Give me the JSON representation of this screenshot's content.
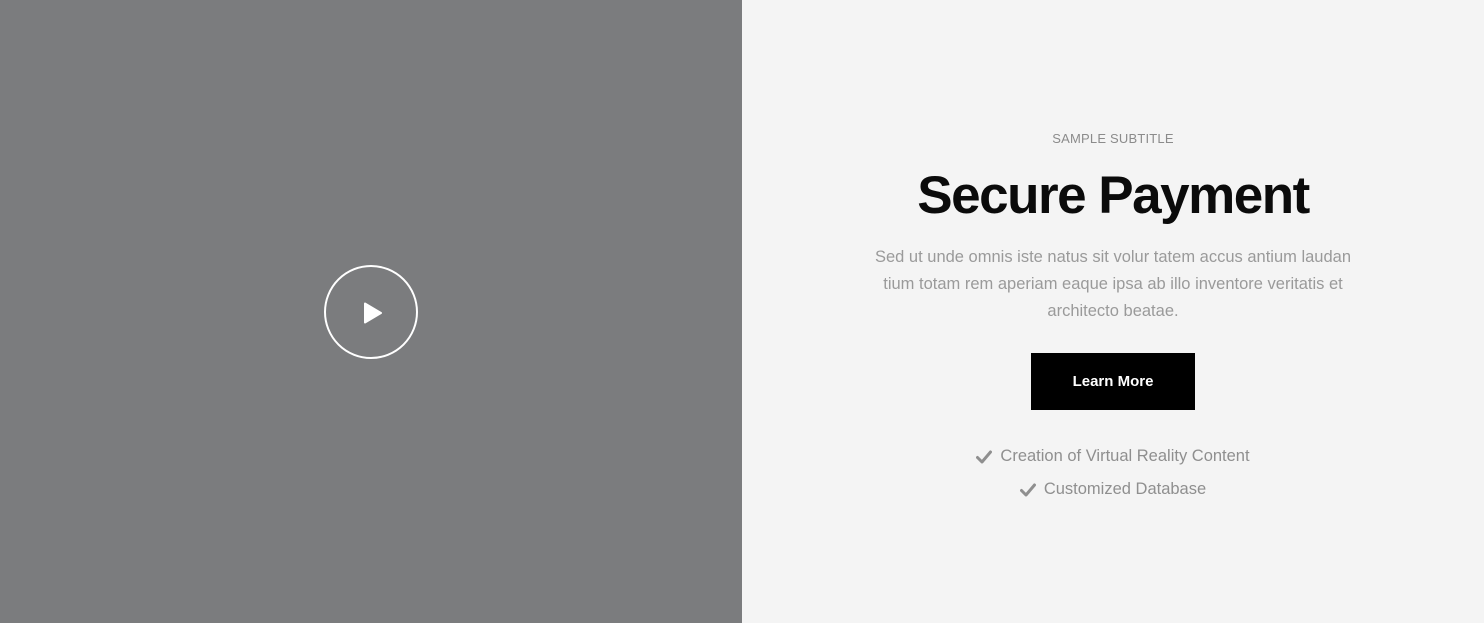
{
  "video": {
    "play_icon": "play-icon",
    "background_color": "#7b7c7e"
  },
  "content": {
    "subtitle": "SAMPLE SUBTITLE",
    "title": "Secure Payment",
    "description": "Sed ut unde omnis iste natus sit volur tatem accus antium laudan tium totam rem aperiam eaque ipsa ab illo inventore veritatis et architecto beatae.",
    "cta_label": "Learn More",
    "background_color": "#f4f4f4",
    "features": [
      {
        "icon": "check-icon",
        "label": "Creation of Virtual Reality Content"
      },
      {
        "icon": "check-icon",
        "label": "Customized Database"
      }
    ]
  }
}
